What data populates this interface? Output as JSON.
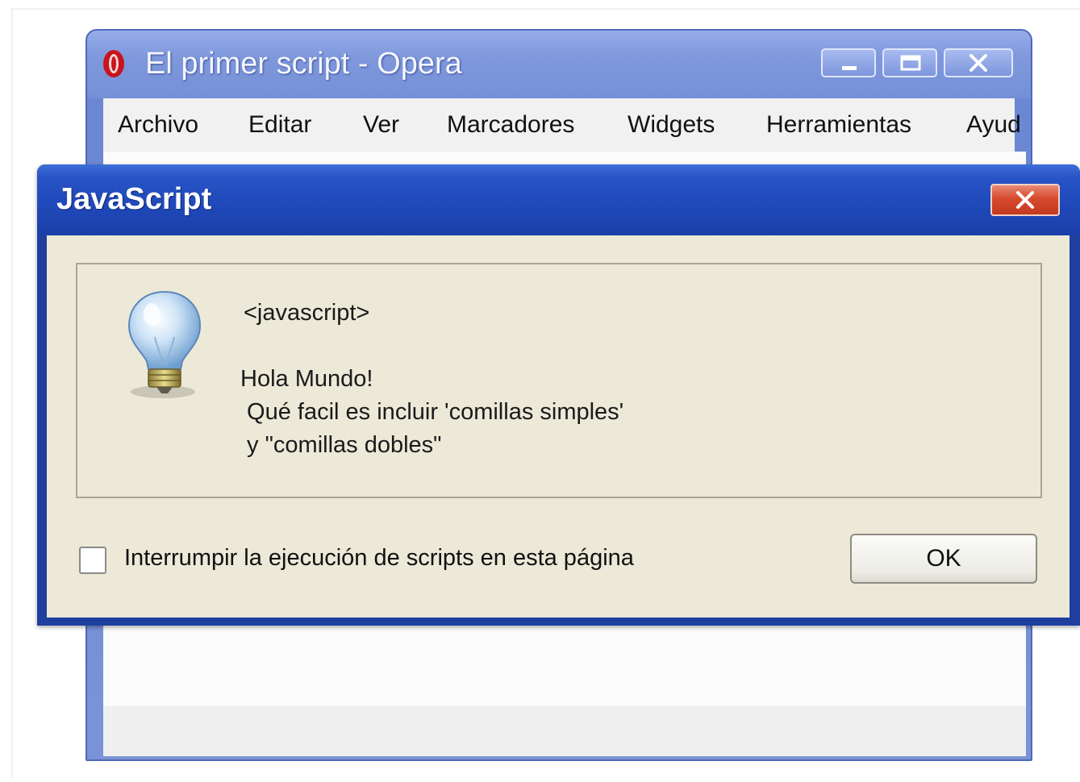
{
  "browser": {
    "title": "El primer script - Opera",
    "logo_icon": "opera-logo-icon",
    "window_controls": [
      "minimize-icon",
      "maximize-icon",
      "close-icon"
    ],
    "menu": [
      "Archivo",
      "Editar",
      "Ver",
      "Marcadores",
      "Widgets",
      "Herramientas",
      "Ayud"
    ]
  },
  "dialog": {
    "title": "JavaScript",
    "close_icon": "close-icon",
    "icon": "lightbulb-icon",
    "source": "<javascript>",
    "message_lines": [
      "Hola Mundo!",
      " Qué facil es incluir 'comillas simples'",
      " y \"comillas dobles\""
    ],
    "checkbox_label": "Interrumpir la ejecución de scripts en esta página",
    "checkbox_checked": false,
    "ok_label": "OK"
  },
  "colors": {
    "dialog_title_blue": "#2753c5",
    "opera_title_blue": "#7f98dc",
    "close_red": "#d64a2e",
    "dialog_body": "#ece9d8"
  }
}
